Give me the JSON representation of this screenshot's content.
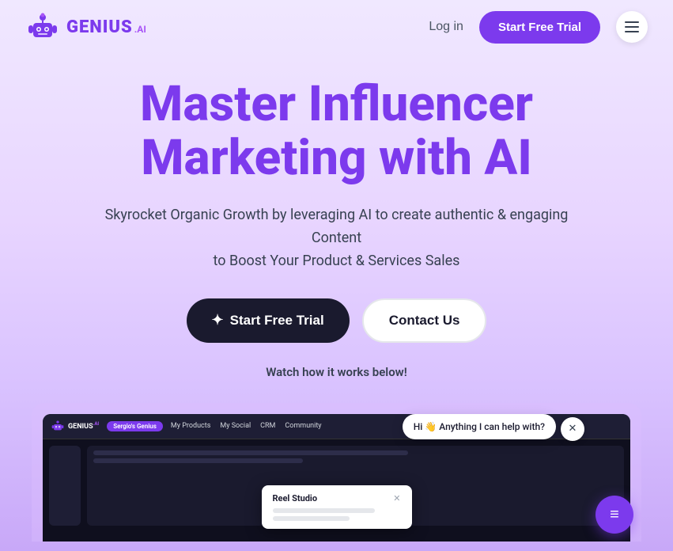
{
  "header": {
    "logo_text": "GENIUS",
    "logo_sup": ".AI",
    "login_label": "Log in",
    "trial_button_label": "Start Free Trial",
    "menu_label": "Menu"
  },
  "hero": {
    "title_line1": "Master Influencer",
    "title_line2": "Marketing with AI",
    "subtitle_line1": "Skyrocket Organic Growth by leveraging AI to create authentic & engaging",
    "subtitle_line2": "Content",
    "subtitle_line3": "to Boost Your Product & Services Sales",
    "start_trial_label": "Start Free Trial",
    "contact_label": "Contact Us",
    "watch_text": "Watch how it works below!"
  },
  "chat": {
    "bubble_text": "Hi 👋 Anything I can help with?",
    "button_icon": "💬"
  },
  "screenshot": {
    "close_icon": "✕",
    "reel_title": "Reel Studio",
    "reel_close": "✕",
    "nav_items": [
      "My Products",
      "My Social",
      "CRM",
      "Community"
    ],
    "sergio_badge": "Sergio's Genius"
  },
  "colors": {
    "brand_purple": "#7c3aed",
    "dark": "#1a1a2e",
    "white": "#ffffff"
  }
}
